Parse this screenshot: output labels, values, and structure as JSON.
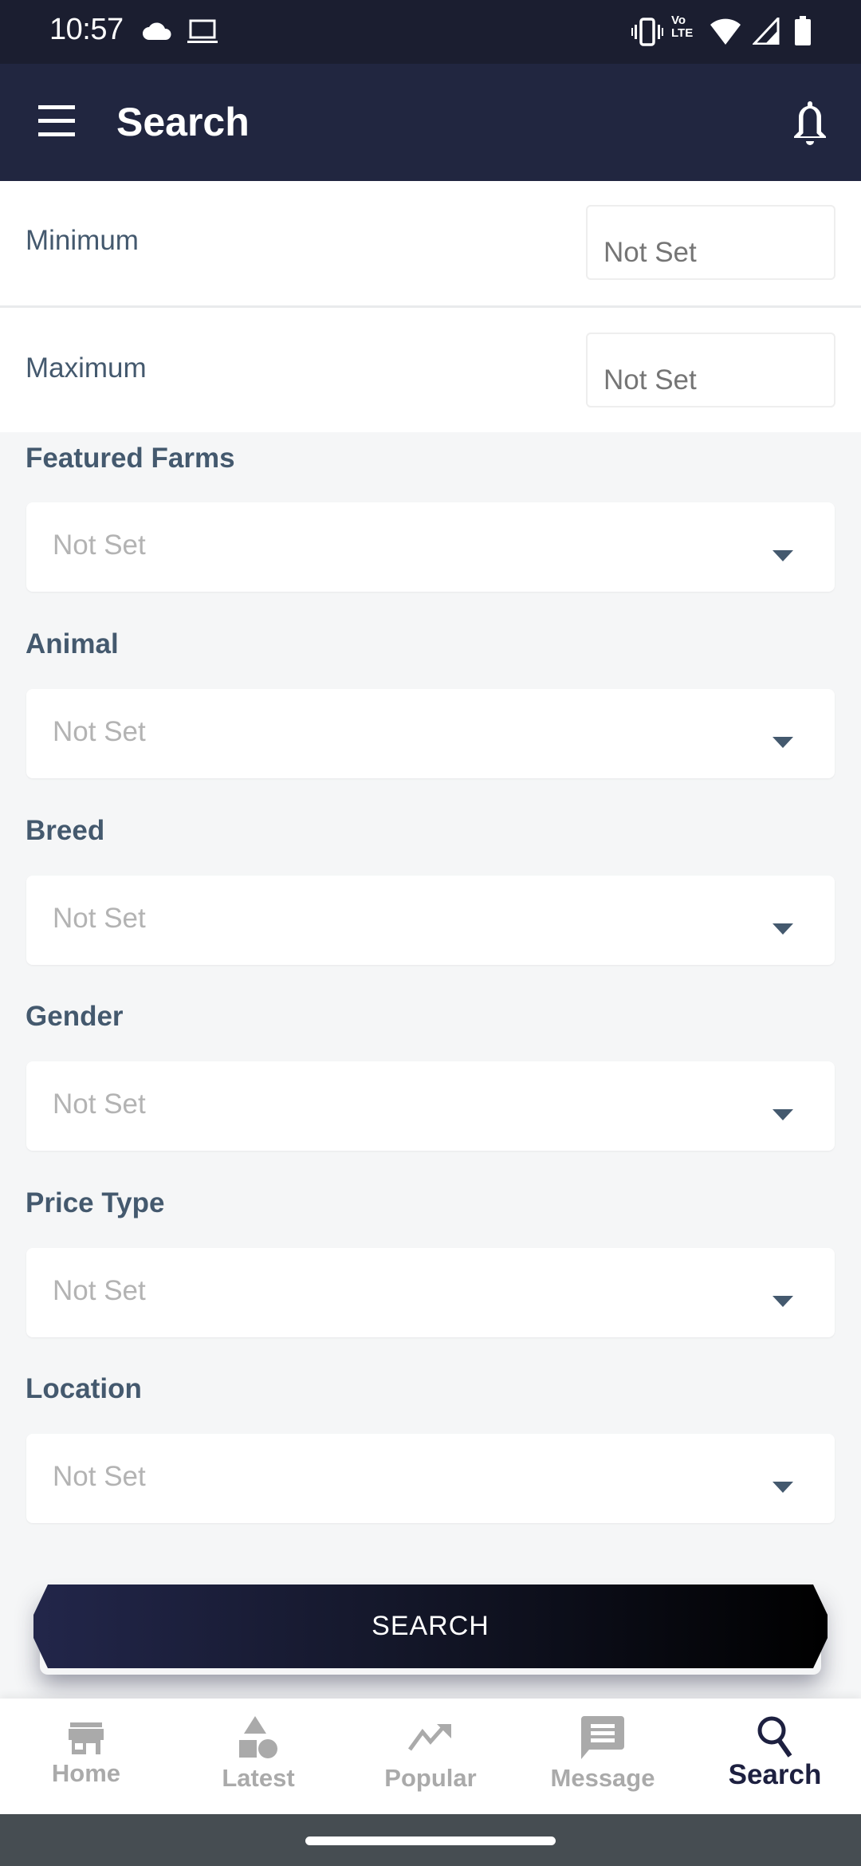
{
  "status_bar": {
    "time": "10:57",
    "left_icons": [
      "cloud-icon",
      "laptop-icon"
    ],
    "right_icons": [
      "vibrate-icon",
      "volte-icon",
      "wifi-icon",
      "signal-icon",
      "battery-icon"
    ],
    "volte_text_top": "Vo",
    "volte_text_bottom": "LTE"
  },
  "app_bar": {
    "title": "Search",
    "menu_icon": "hamburger-menu-icon",
    "notification_icon": "bell-icon"
  },
  "range": {
    "minimum": {
      "label": "Minimum",
      "placeholder": "Not Set",
      "value": ""
    },
    "maximum": {
      "label": "Maximum",
      "placeholder": "Not Set",
      "value": ""
    }
  },
  "filters": [
    {
      "label": "Featured Farms",
      "value": "Not Set"
    },
    {
      "label": "Animal",
      "value": "Not Set"
    },
    {
      "label": "Breed",
      "value": "Not Set"
    },
    {
      "label": "Gender",
      "value": "Not Set"
    },
    {
      "label": "Price Type",
      "value": "Not Set"
    },
    {
      "label": "Location",
      "value": "Not Set"
    }
  ],
  "search_button": {
    "label": "SEARCH"
  },
  "bottom_nav": {
    "active": "Search",
    "items": [
      {
        "label": "Home",
        "icon": "store-icon"
      },
      {
        "label": "Latest",
        "icon": "shapes-icon"
      },
      {
        "label": "Popular",
        "icon": "trending-up-icon"
      },
      {
        "label": "Message",
        "icon": "message-icon"
      },
      {
        "label": "Search",
        "icon": "search-icon"
      }
    ]
  },
  "colors": {
    "app_bar": "#212640",
    "status_bar": "#1b1e30",
    "label_text": "#44596e",
    "placeholder_text": "#b3b3b3",
    "nav_inactive": "#aaaaaa",
    "nav_active": "#1d2040",
    "page_background": "#f5f6f7"
  }
}
